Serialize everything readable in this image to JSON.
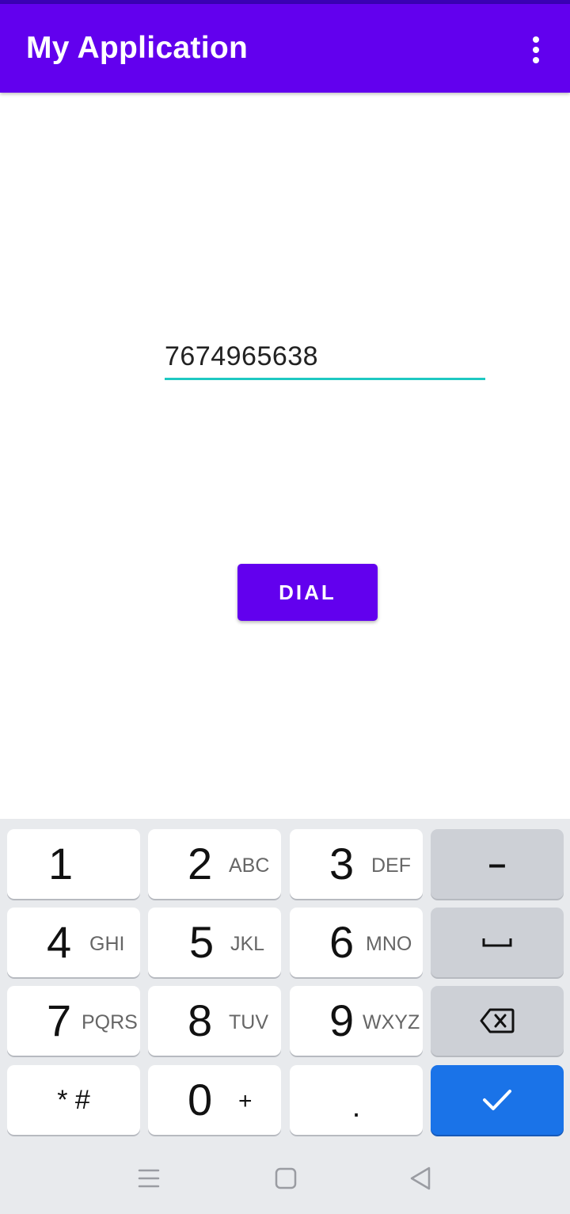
{
  "app_bar": {
    "title": "My Application",
    "overflow_icon": "more-vert-icon",
    "background_color": "#6200ee"
  },
  "main": {
    "phone_input": {
      "value": "7674965638",
      "underline_color": "#1ec8c2"
    },
    "dial_button": {
      "label": "DIAL"
    }
  },
  "keyboard": {
    "rows": [
      [
        {
          "digit": "1",
          "letters": ""
        },
        {
          "digit": "2",
          "letters": "ABC"
        },
        {
          "digit": "3",
          "letters": "DEF"
        },
        {
          "symbol": "–",
          "icon": "minus-icon"
        }
      ],
      [
        {
          "digit": "4",
          "letters": "GHI"
        },
        {
          "digit": "5",
          "letters": "JKL"
        },
        {
          "digit": "6",
          "letters": "MNO"
        },
        {
          "icon": "space-icon"
        }
      ],
      [
        {
          "digit": "7",
          "letters": "PQRS"
        },
        {
          "digit": "8",
          "letters": "TUV"
        },
        {
          "digit": "9",
          "letters": "WXYZ"
        },
        {
          "icon": "backspace-icon"
        }
      ],
      [
        {
          "symbol": "* #"
        },
        {
          "digit": "0",
          "letters": "+"
        },
        {
          "symbol": "."
        },
        {
          "icon": "checkmark-icon",
          "color": "#1a73e8"
        }
      ]
    ]
  },
  "navigation_bar": {
    "buttons": [
      "menu-icon",
      "home-square-icon",
      "back-triangle-icon"
    ]
  }
}
